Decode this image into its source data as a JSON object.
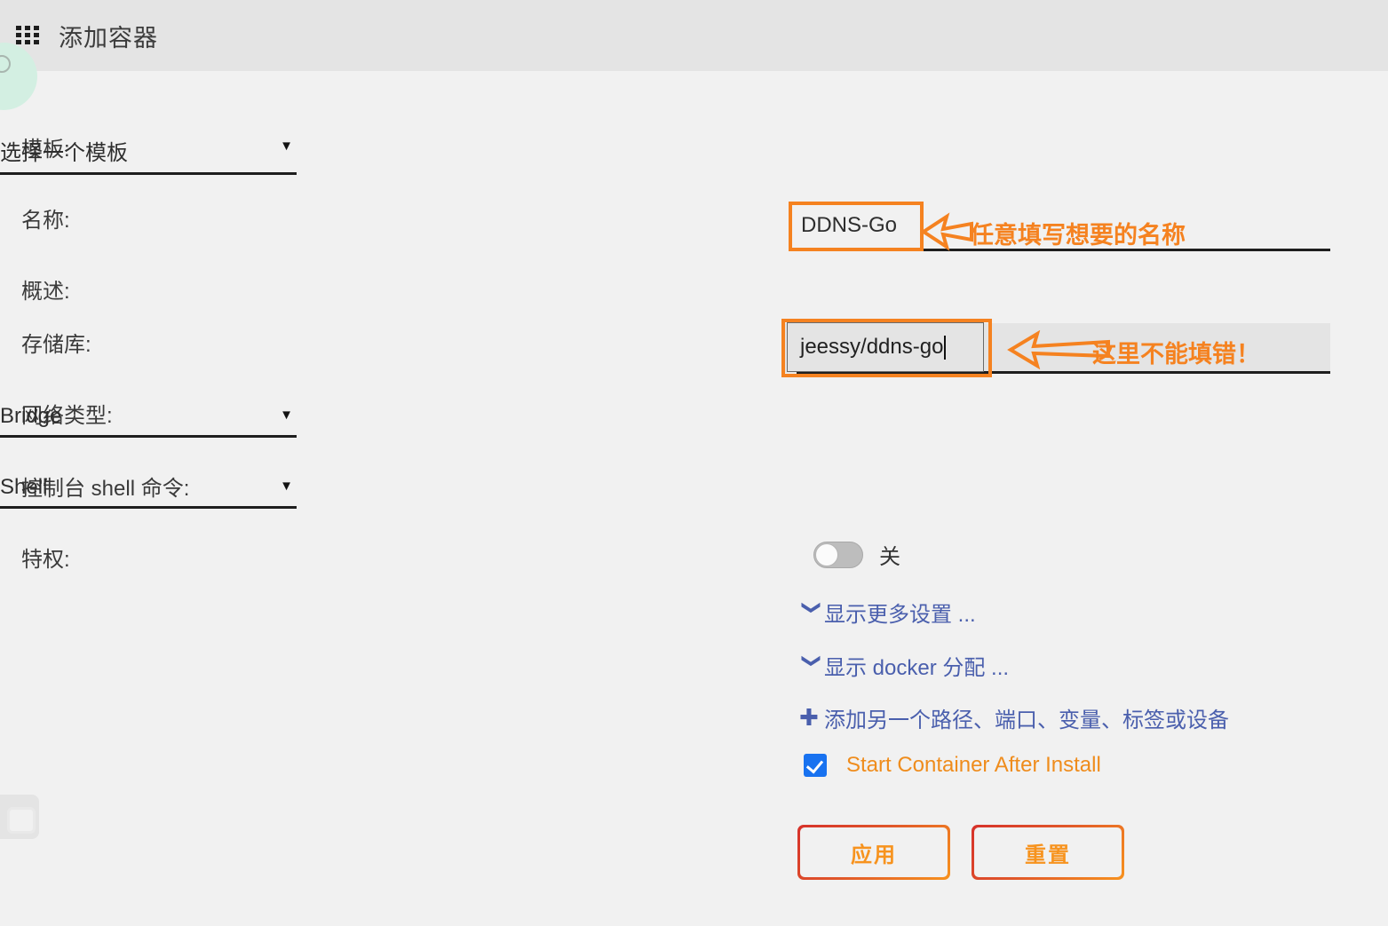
{
  "window": {
    "title": "添加容器",
    "icon": "grid-3x3-icon",
    "header_bg": "#e4e4e4",
    "body_bg": "#f1f1f1"
  },
  "form": {
    "rows": [
      {
        "label": "模板:",
        "value": "选择一个模板",
        "control": "select"
      },
      {
        "label": "名称:",
        "value": "DDNS-Go",
        "control": "text"
      },
      {
        "label": "概述:",
        "value": "",
        "control": "none"
      },
      {
        "label": "存储库:",
        "value": "jeessy/ddns-go",
        "control": "text-focused"
      },
      {
        "label": "网络类型:",
        "value": "Bridge",
        "control": "select"
      },
      {
        "label": "控制台 shell 命令:",
        "value": "Shell",
        "control": "select"
      },
      {
        "label": "特权:",
        "value": "关",
        "control": "toggle"
      }
    ],
    "template_select": {
      "label": "模板:",
      "value": "选择一个模板",
      "caret": "▼"
    },
    "name_field": {
      "label": "名称:",
      "value": "DDNS-Go"
    },
    "overview_field": {
      "label": "概述:",
      "value": ""
    },
    "repository_field": {
      "label": "存储库:",
      "value": "jeessy/ddns-go"
    },
    "network_select": {
      "label": "网络类型:",
      "value": "Bridge",
      "caret": "▼"
    },
    "shell_select": {
      "label": "控制台 shell 命令:",
      "value": "Shell",
      "caret": "▼"
    },
    "privileged_toggle": {
      "label": "特权:",
      "state_label": "关",
      "on": false
    }
  },
  "links": [
    {
      "icon": "chevron-down-icon",
      "glyph": "❯",
      "label": "显示更多设置 ..."
    },
    {
      "icon": "chevron-down-icon",
      "glyph": "❯",
      "label": "显示 docker 分配 ..."
    },
    {
      "icon": "plus-icon",
      "glyph": "✚",
      "label": "添加另一个路径、端口、变量、标签或设备"
    }
  ],
  "start_after_install": {
    "label": "Start Container After Install",
    "checked": true,
    "label_color": "#ef8c1c",
    "box_color": "#1872f0"
  },
  "buttons": {
    "apply": "应用",
    "reset": "重置",
    "border_gradient_from": "#d6312a",
    "border_gradient_to": "#f7921e",
    "text_color": "#f7931e"
  },
  "annotations": {
    "color": "#f58220",
    "items": [
      {
        "target": "name-field",
        "text": "任意填写想要的名称",
        "arrow": "left-arrow-outline-short"
      },
      {
        "target": "repository-field",
        "text": "这里不能填错！",
        "arrow": "left-arrow-outline-long"
      }
    ]
  },
  "decorations": {
    "edge_circle_color": "#d3efe2",
    "edge_panel_color": "#e4e4e4"
  }
}
